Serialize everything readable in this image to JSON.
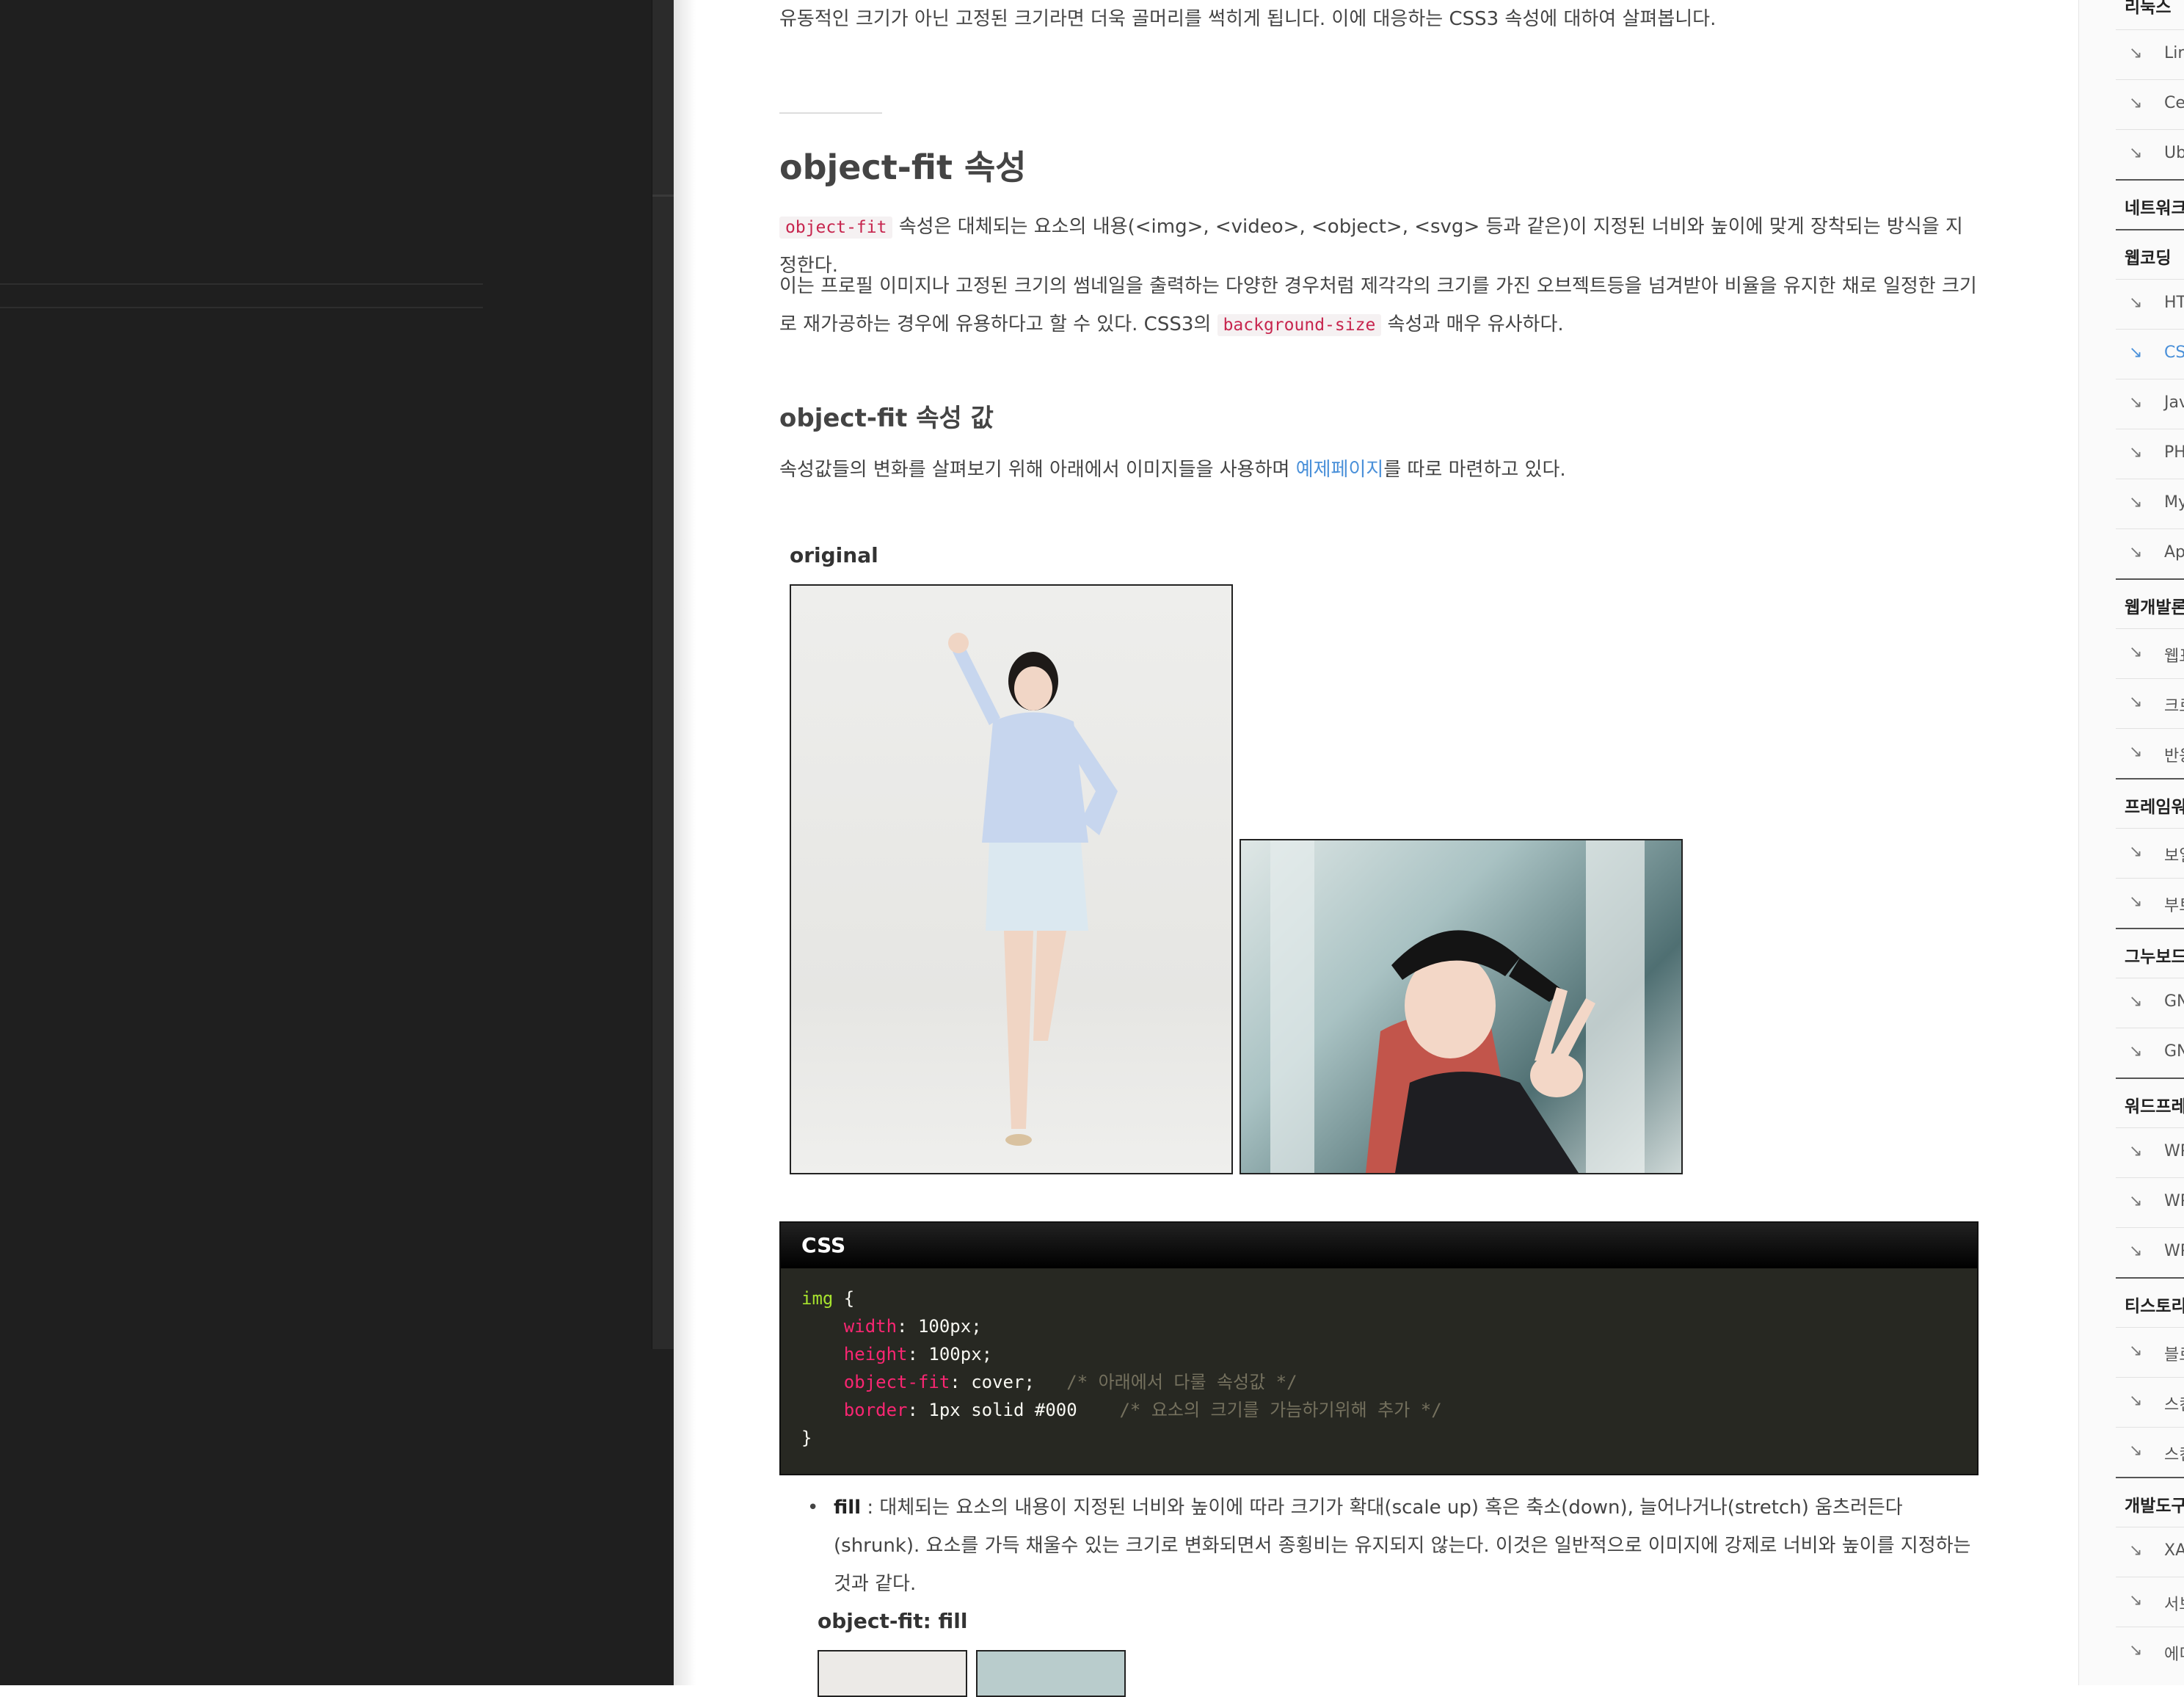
{
  "intro_text": "유동적인 크기가 아닌 고정된 크기라면 더욱 골머리를 썩히게 됩니다. 이에 대응하는 CSS3 속성에 대하여 살펴봅니다.",
  "section_title": "object-fit 속성",
  "para1": {
    "code": "object-fit",
    "text": " 속성은 대체되는 요소의 내용(<img>, <video>, <object>, <svg> 등과 같은)이 지정된 너비와 높이에 맞게 장착되는 방식을 지정한다."
  },
  "para2": {
    "text_before": "이는 프로필 이미지나 고정된 크기의 썸네일을 출력하는 다양한 경우처럼 제각각의 크기를 가진 오브젝트등을 넘겨받아 비율을 유지한 채로 일정한 크기로 재가공하는 경우에 유용하다고 할 수 있다. CSS3의 ",
    "code": "background-size",
    "text_after": " 속성과 매우 유사하다."
  },
  "subsection_title": "object-fit 속성 값",
  "para3": {
    "text_before": "속성값들의 변화를 살펴보기 위해 아래에서 이미지들을 사용하며 ",
    "link": "예제페이지",
    "text_after": "를 따로 마련하고 있다."
  },
  "demo_original_label": "original",
  "code_box": {
    "title": "CSS",
    "lines": {
      "l1_sel": "img",
      "l1_rest": " {",
      "l2_prop": "width",
      "l2_val": ": 100px;",
      "l3_prop": "height",
      "l3_val": ": 100px;",
      "l4_prop": "object-fit",
      "l4_val": ": cover;",
      "l4_cmt": "/* 아래에서 다룰 속성값 */",
      "l5_prop": "border",
      "l5_val": ": 1px solid #000",
      "l5_cmt": "/* 요소의 크기를 가늠하기위해 추가 */",
      "l6": "}"
    }
  },
  "bullet_fill": {
    "term": "fill",
    "text": " : 대체되는 요소의 내용이 지정된 너비와 높이에 따라 크기가 확대(scale up) 혹은 축소(down), 늘어나거나(stretch) 움츠러든다(shrunk). 요소를 가득 채울수 있는 크기로 변화되면서 종횡비는 유지되지 않는다. 이것은 일반적으로 이미지에 강제로 너비와 높이를 지정하는 것과 같다."
  },
  "demo_fill_label": "object-fit: fill",
  "sidebar": {
    "arrow": "↘",
    "top_cat": "리눅스",
    "linux_items": [
      "Linu",
      "Cen",
      "Ubu"
    ],
    "cat_network": "네트워크",
    "cat_webcoding": "웹코딩",
    "webcoding_items": [
      "HTM",
      "CSS",
      "Java",
      "PHP",
      "MyS",
      "App"
    ],
    "cat_webdev": "웹개발론",
    "webdev_items": [
      "웹표",
      "크로",
      "반응"
    ],
    "cat_framework": "프레임워크",
    "framework_items": [
      "보일",
      "부트"
    ],
    "cat_gnuboard": "그누보드",
    "gnuboard_items": [
      "GNU",
      "GNU"
    ],
    "cat_wordpress": "워드프레스",
    "wordpress_items": [
      "WP",
      "WP",
      "WP"
    ],
    "cat_tistory": "티스토리",
    "tistory_items": [
      "블로",
      "스킨",
      "스킨"
    ],
    "cat_devtools": "개발도구",
    "devtools_items": [
      "XAM",
      "서브",
      "에디"
    ]
  }
}
